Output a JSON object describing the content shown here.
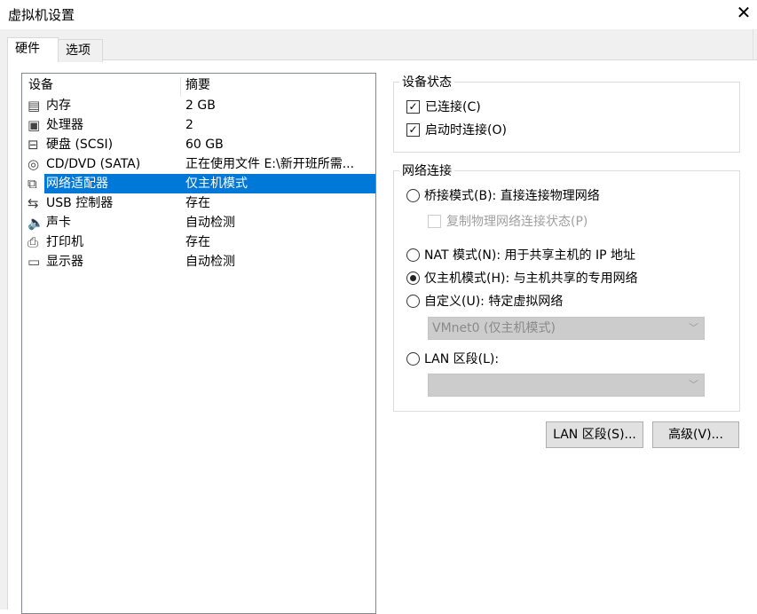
{
  "window": {
    "title": "虚拟机设置",
    "close_icon": "close-icon"
  },
  "tabs": [
    {
      "label": "硬件",
      "active": true
    },
    {
      "label": "选项",
      "active": false
    }
  ],
  "device_list": {
    "headers": [
      "设备",
      "摘要"
    ],
    "rows": [
      {
        "device": "内存",
        "summary": "2 GB",
        "icon": "memory-icon"
      },
      {
        "device": "处理器",
        "summary": "2",
        "icon": "cpu-icon"
      },
      {
        "device": "硬盘 (SCSI)",
        "summary": "60 GB",
        "icon": "hard-disk-icon"
      },
      {
        "device": "CD/DVD (SATA)",
        "summary": "正在使用文件 E:\\新开班所需...",
        "icon": "cd-dvd-icon"
      },
      {
        "device": "网络适配器",
        "summary": "仅主机模式",
        "icon": "network-adapter-icon",
        "selected": true
      },
      {
        "device": "USB 控制器",
        "summary": "存在",
        "icon": "usb-icon"
      },
      {
        "device": "声卡",
        "summary": "自动检测",
        "icon": "speaker-icon"
      },
      {
        "device": "打印机",
        "summary": "存在",
        "icon": "printer-icon"
      },
      {
        "device": "显示器",
        "summary": "自动检测",
        "icon": "monitor-icon"
      }
    ]
  },
  "device_status": {
    "title": "设备状态",
    "connected": {
      "label": "已连接(C)",
      "checked": true
    },
    "connect_at_power_on": {
      "label": "启动时连接(O)",
      "checked": true
    }
  },
  "network": {
    "title": "网络连接",
    "bridged": {
      "label": "桥接模式(B): 直接连接物理网络",
      "checked": false
    },
    "replicate": {
      "label": "复制物理网络连接状态(P)",
      "checked": false,
      "disabled": true
    },
    "nat": {
      "label": "NAT 模式(N): 用于共享主机的 IP 地址",
      "checked": false
    },
    "host_only": {
      "label": "仅主机模式(H): 与主机共享的专用网络",
      "checked": true
    },
    "custom": {
      "label": "自定义(U): 特定虚拟网络",
      "checked": false,
      "select_value": "VMnet0 (仅主机模式)"
    },
    "lan_segment": {
      "label": "LAN 区段(L):",
      "checked": false,
      "select_value": ""
    }
  },
  "buttons": {
    "lan_segments": "LAN 区段(S)...",
    "advanced": "高级(V)..."
  },
  "colors": {
    "selection": "#0078d7"
  }
}
